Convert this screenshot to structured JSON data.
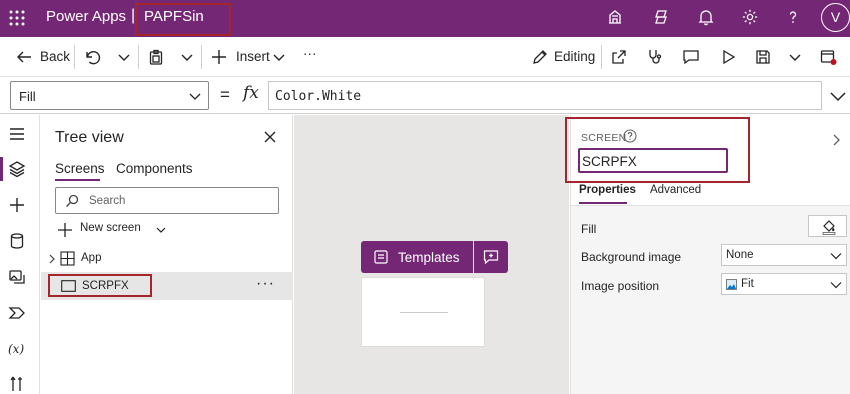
{
  "topbar": {
    "app_title": "Power Apps",
    "separator": "|",
    "app_name": "PAPFSin",
    "avatar_initial": "V",
    "icons": [
      "waffle-icon",
      "environment-icon",
      "copilot-icon",
      "bell-icon",
      "gear-icon",
      "help-icon"
    ]
  },
  "commandbar": {
    "back_label": "Back",
    "insert_label": "Insert",
    "more_label": "···",
    "editing_label": "Editing"
  },
  "formulabar": {
    "property": "Fill",
    "equals": "=",
    "fx": "fx",
    "formula": "Color.White"
  },
  "treeview": {
    "title": "Tree view",
    "tabs": [
      "Screens",
      "Components"
    ],
    "search_placeholder": "Search",
    "new_screen_label": "New screen",
    "items": [
      {
        "label": "App"
      },
      {
        "label": "SCRPFX"
      }
    ],
    "more_label": "···"
  },
  "canvas": {
    "templates_label": "Templates"
  },
  "properties": {
    "section_label": "SCREEN",
    "screen_name": "SCRPFX",
    "tabs": [
      "Properties",
      "Advanced"
    ],
    "rows": [
      {
        "label": "Fill"
      },
      {
        "label": "Background image",
        "value": "None"
      },
      {
        "label": "Image position",
        "value": "Fit"
      }
    ]
  },
  "colors": {
    "brand": "#742774",
    "highlight_border": "#a4262c"
  }
}
